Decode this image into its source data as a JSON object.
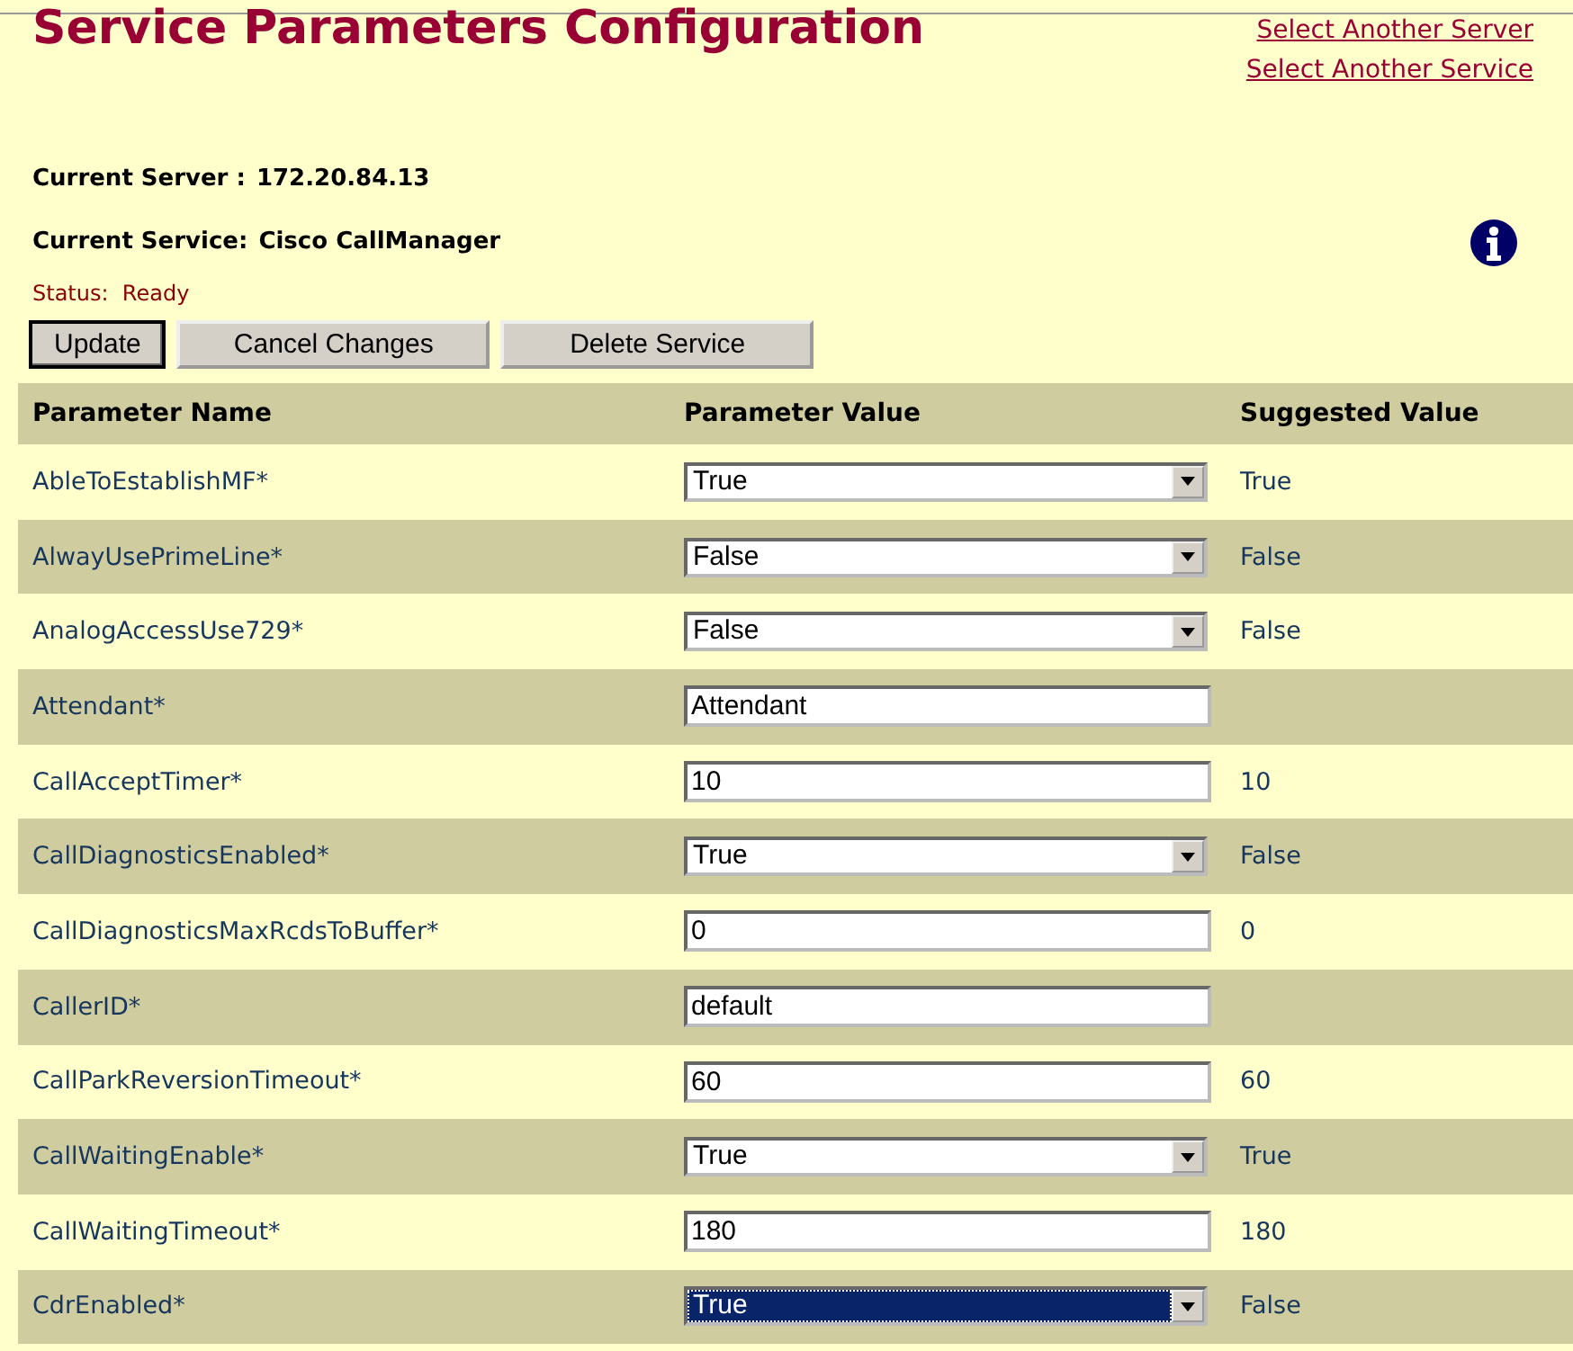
{
  "title": "Service Parameters Configuration",
  "links": [
    "Select Another Server",
    "Select Another Service"
  ],
  "current_server": {
    "label": "Current Server :",
    "value": "172.20.84.13"
  },
  "current_service": {
    "label": "Current Service:",
    "value": "Cisco CallManager"
  },
  "status": {
    "label": "Status:",
    "value": "Ready"
  },
  "buttons": [
    "Update",
    "Cancel Changes",
    "Delete Service"
  ],
  "table": {
    "columns": [
      "Parameter Name",
      "Parameter Value",
      "Suggested Value"
    ],
    "rows": [
      {
        "name": "AbleToEstablishMF*",
        "kind": "select",
        "value": "True",
        "suggested": "True",
        "focused": false
      },
      {
        "name": "AlwayUsePrimeLine*",
        "kind": "select",
        "value": "False",
        "suggested": "False",
        "focused": false
      },
      {
        "name": "AnalogAccessUse729*",
        "kind": "select",
        "value": "False",
        "suggested": "False",
        "focused": false
      },
      {
        "name": "Attendant*",
        "kind": "text",
        "value": "Attendant"
      },
      {
        "name": "CallAcceptTimer*",
        "kind": "text",
        "value": "10",
        "suggested": "10"
      },
      {
        "name": "CallDiagnosticsEnabled*",
        "kind": "select",
        "value": "True",
        "suggested": "False",
        "focused": false
      },
      {
        "name": "CallDiagnosticsMaxRcdsToBuffer*",
        "kind": "text",
        "value": "0",
        "suggested": "0"
      },
      {
        "name": "CallerID*",
        "kind": "text",
        "value": "default"
      },
      {
        "name": "CallParkReversionTimeout*",
        "kind": "text",
        "value": "60",
        "suggested": "60"
      },
      {
        "name": "CallWaitingEnable*",
        "kind": "select",
        "value": "True",
        "suggested": "True",
        "focused": false
      },
      {
        "name": "CallWaitingTimeout*",
        "kind": "text",
        "value": "180",
        "suggested": "180"
      },
      {
        "name": "CdrEnabled*",
        "kind": "select",
        "value": "True",
        "suggested": "False",
        "focused": true
      }
    ]
  }
}
